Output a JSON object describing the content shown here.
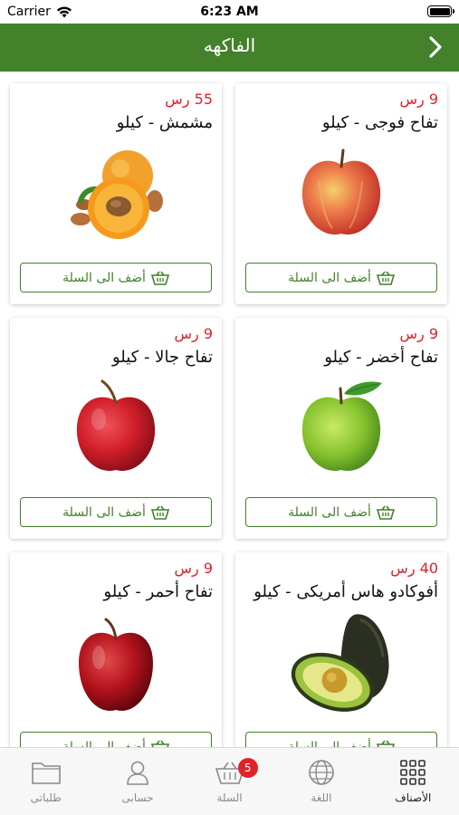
{
  "status": {
    "carrier": "Carrier",
    "time": "6:23 AM"
  },
  "header": {
    "title": "الفاكهه",
    "back_icon": "chevron-right-icon"
  },
  "add_label": "أضف الى السلة",
  "products": [
    {
      "price": "9 رس",
      "name": "تفاح فوجى - كيلو",
      "image": "apple-fuji"
    },
    {
      "price": "55 رس",
      "name": "مشمش - كيلو",
      "image": "apricot"
    },
    {
      "price": "9 رس",
      "name": "تفاح أخضر - كيلو",
      "image": "apple-green"
    },
    {
      "price": "9 رس",
      "name": "تفاح جالا - كيلو",
      "image": "apple-gala"
    },
    {
      "price": "40 رس",
      "name": "أفوكادو هاس أمريكى - كيلو",
      "image": "avocado"
    },
    {
      "price": "9 رس",
      "name": "تفاح أحمر - كيلو",
      "image": "apple-red"
    }
  ],
  "tabbar": {
    "categories": "الأصناف",
    "language": "اللغة",
    "cart": "السلة",
    "cart_count": "5",
    "account": "حسابى",
    "orders": "طلباتى"
  },
  "colors": {
    "brand": "#43812b",
    "price": "#e0222a"
  }
}
